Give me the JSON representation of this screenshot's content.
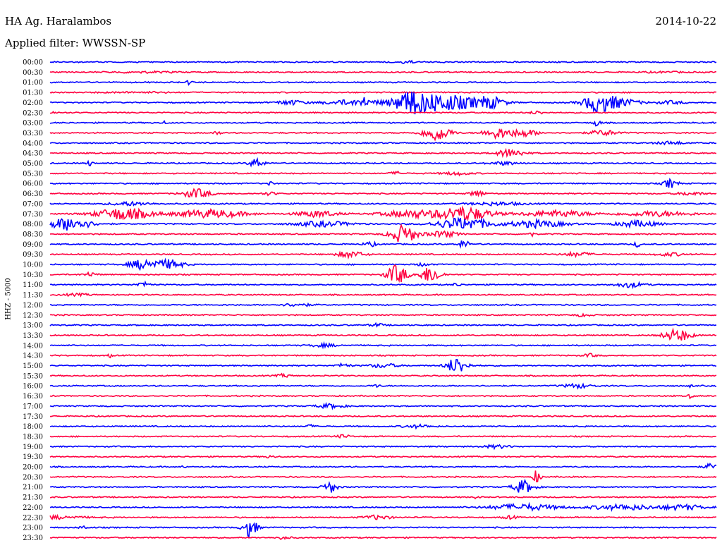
{
  "header": {
    "station": "HA Ag. Haralambos",
    "filter": "Applied filter: WWSSN-SP",
    "date": "2014-10-22"
  },
  "channel_label": "HHZ - 5000",
  "colors": {
    "even_trace": "#0000ff",
    "odd_trace": "#ff0040",
    "text": "#000000",
    "background": "#ffffff"
  },
  "traces": [
    {
      "label": "00:00",
      "events": [
        [
          0.54,
          0.2,
          0.02
        ]
      ]
    },
    {
      "label": "00:30",
      "events": [
        [
          0.14,
          0.12,
          0.05
        ],
        [
          0.92,
          0.1,
          0.03
        ]
      ]
    },
    {
      "label": "01:00",
      "events": [
        [
          0.21,
          0.6,
          0.004
        ]
      ]
    },
    {
      "label": "01:30",
      "events": [
        [
          0.13,
          0.1,
          0.05
        ]
      ]
    },
    {
      "label": "02:00",
      "events": [
        [
          0.36,
          0.45,
          0.02
        ],
        [
          0.45,
          0.45,
          0.04
        ],
        [
          0.47,
          0.8,
          0.005
        ],
        [
          0.54,
          1.4,
          0.02
        ],
        [
          0.58,
          1.8,
          0.06
        ],
        [
          0.66,
          1.0,
          0.02
        ],
        [
          0.82,
          1.6,
          0.02
        ],
        [
          0.85,
          0.9,
          0.03
        ],
        [
          0.93,
          0.3,
          0.02
        ]
      ]
    },
    {
      "label": "02:30",
      "events": [
        [
          0.0,
          0.2,
          0.01
        ],
        [
          0.73,
          0.3,
          0.01
        ]
      ]
    },
    {
      "label": "03:00",
      "events": [
        [
          0.17,
          0.3,
          0.004
        ],
        [
          0.82,
          0.8,
          0.005
        ]
      ]
    },
    {
      "label": "03:30",
      "events": [
        [
          0.25,
          0.4,
          0.005
        ],
        [
          0.58,
          1.5,
          0.02
        ],
        [
          0.67,
          1.0,
          0.02
        ],
        [
          0.71,
          0.7,
          0.02
        ],
        [
          0.83,
          0.5,
          0.02
        ]
      ]
    },
    {
      "label": "04:00",
      "events": [
        [
          0.93,
          0.3,
          0.02
        ]
      ]
    },
    {
      "label": "04:30",
      "events": [
        [
          0.69,
          0.8,
          0.02
        ]
      ]
    },
    {
      "label": "05:00",
      "events": [
        [
          0.06,
          0.6,
          0.004
        ],
        [
          0.31,
          1.0,
          0.01
        ],
        [
          0.68,
          0.3,
          0.02
        ]
      ]
    },
    {
      "label": "05:30",
      "events": [
        [
          0.52,
          0.3,
          0.01
        ],
        [
          0.61,
          0.3,
          0.02
        ]
      ]
    },
    {
      "label": "06:00",
      "events": [
        [
          0.33,
          0.6,
          0.003
        ],
        [
          0.93,
          0.9,
          0.01
        ]
      ]
    },
    {
      "label": "06:30",
      "events": [
        [
          0.22,
          0.9,
          0.02
        ],
        [
          0.33,
          0.3,
          0.01
        ],
        [
          0.64,
          0.7,
          0.01
        ],
        [
          0.96,
          0.3,
          0.02
        ]
      ]
    },
    {
      "label": "07:00",
      "events": [
        [
          0.12,
          0.35,
          0.03
        ],
        [
          0.67,
          0.3,
          0.04
        ]
      ]
    },
    {
      "label": "07:30",
      "events": [
        [
          0.11,
          1.2,
          0.04
        ],
        [
          0.24,
          0.8,
          0.05
        ],
        [
          0.4,
          0.6,
          0.03
        ],
        [
          0.54,
          0.7,
          0.04
        ],
        [
          0.62,
          1.4,
          0.04
        ],
        [
          0.76,
          0.6,
          0.05
        ],
        [
          0.91,
          0.5,
          0.05
        ]
      ]
    },
    {
      "label": "08:00",
      "events": [
        [
          0.03,
          1.3,
          0.03
        ],
        [
          0.41,
          0.5,
          0.04
        ],
        [
          0.62,
          1.2,
          0.04
        ],
        [
          0.73,
          0.7,
          0.04
        ],
        [
          0.88,
          0.6,
          0.03
        ]
      ]
    },
    {
      "label": "08:30",
      "events": [
        [
          0.53,
          1.8,
          0.02
        ],
        [
          0.59,
          0.6,
          0.02
        ],
        [
          0.72,
          0.7,
          0.004
        ]
      ]
    },
    {
      "label": "09:00",
      "events": [
        [
          0.48,
          0.4,
          0.01
        ],
        [
          0.62,
          0.8,
          0.008
        ],
        [
          0.88,
          0.6,
          0.004
        ]
      ]
    },
    {
      "label": "09:30",
      "events": [
        [
          0.45,
          0.6,
          0.02
        ],
        [
          0.79,
          0.4,
          0.02
        ],
        [
          0.93,
          0.3,
          0.02
        ]
      ]
    },
    {
      "label": "10:00",
      "events": [
        [
          0.14,
          1.0,
          0.02
        ],
        [
          0.18,
          0.9,
          0.02
        ],
        [
          0.56,
          0.3,
          0.01
        ]
      ]
    },
    {
      "label": "10:30",
      "events": [
        [
          0.06,
          0.4,
          0.01
        ],
        [
          0.52,
          1.9,
          0.015
        ],
        [
          0.57,
          1.6,
          0.015
        ]
      ]
    },
    {
      "label": "11:00",
      "events": [
        [
          0.14,
          0.5,
          0.01
        ],
        [
          0.61,
          0.4,
          0.005
        ],
        [
          0.87,
          0.5,
          0.02
        ]
      ]
    },
    {
      "label": "11:30",
      "events": [
        [
          0.04,
          0.2,
          0.02
        ]
      ]
    },
    {
      "label": "12:00",
      "events": [
        [
          0.37,
          0.3,
          0.02
        ]
      ]
    },
    {
      "label": "12:30",
      "events": [
        [
          0.8,
          0.3,
          0.01
        ]
      ]
    },
    {
      "label": "13:00",
      "events": [
        [
          0.0,
          0.2,
          0.01
        ],
        [
          0.49,
          0.3,
          0.01
        ]
      ]
    },
    {
      "label": "13:30",
      "events": [
        [
          0.94,
          1.2,
          0.02
        ]
      ]
    },
    {
      "label": "14:00",
      "events": [
        [
          0.41,
          0.3,
          0.02
        ]
      ]
    },
    {
      "label": "14:30",
      "events": [
        [
          0.09,
          0.4,
          0.003
        ],
        [
          0.81,
          0.3,
          0.01
        ]
      ]
    },
    {
      "label": "15:00",
      "events": [
        [
          0.44,
          0.4,
          0.01
        ],
        [
          0.5,
          0.4,
          0.02
        ],
        [
          0.61,
          1.6,
          0.015
        ]
      ]
    },
    {
      "label": "15:30",
      "events": [
        [
          0.35,
          0.3,
          0.01
        ]
      ]
    },
    {
      "label": "16:00",
      "events": [
        [
          0.49,
          0.3,
          0.005
        ],
        [
          0.79,
          0.4,
          0.02
        ],
        [
          0.96,
          0.3,
          0.003
        ]
      ]
    },
    {
      "label": "16:30",
      "events": [
        [
          0.0,
          0.2,
          0.005
        ],
        [
          0.96,
          0.5,
          0.003
        ]
      ]
    },
    {
      "label": "17:00",
      "events": [
        [
          0.42,
          0.4,
          0.02
        ]
      ]
    },
    {
      "label": "17:30",
      "events": []
    },
    {
      "label": "18:00",
      "events": [
        [
          0.39,
          0.3,
          0.005
        ],
        [
          0.55,
          0.3,
          0.02
        ]
      ]
    },
    {
      "label": "18:30",
      "events": [
        [
          0.44,
          0.3,
          0.01
        ]
      ]
    },
    {
      "label": "19:00",
      "events": [
        [
          0.67,
          0.3,
          0.02
        ]
      ]
    },
    {
      "label": "19:30",
      "events": [
        [
          0.33,
          0.2,
          0.01
        ]
      ]
    },
    {
      "label": "20:00",
      "events": [
        [
          0.2,
          0.4,
          0.003
        ],
        [
          0.99,
          0.5,
          0.01
        ]
      ]
    },
    {
      "label": "20:30",
      "events": [
        [
          0.73,
          1.4,
          0.005
        ]
      ]
    },
    {
      "label": "21:00",
      "events": [
        [
          0.42,
          1.1,
          0.01
        ],
        [
          0.71,
          1.3,
          0.015
        ]
      ]
    },
    {
      "label": "21:30",
      "events": [
        [
          0.64,
          0.4,
          0.003
        ]
      ]
    },
    {
      "label": "22:00",
      "events": [
        [
          0.71,
          0.6,
          0.05
        ],
        [
          0.86,
          0.5,
          0.05
        ],
        [
          0.95,
          0.5,
          0.03
        ]
      ]
    },
    {
      "label": "22:30",
      "events": [
        [
          0.0,
          0.3,
          0.05
        ],
        [
          0.49,
          0.4,
          0.02
        ],
        [
          0.69,
          0.3,
          0.01
        ]
      ]
    },
    {
      "label": "23:00",
      "events": [
        [
          0.05,
          0.4,
          0.005
        ],
        [
          0.3,
          1.9,
          0.01
        ]
      ]
    },
    {
      "label": "23:30",
      "events": [
        [
          0.35,
          0.3,
          0.01
        ]
      ]
    }
  ]
}
